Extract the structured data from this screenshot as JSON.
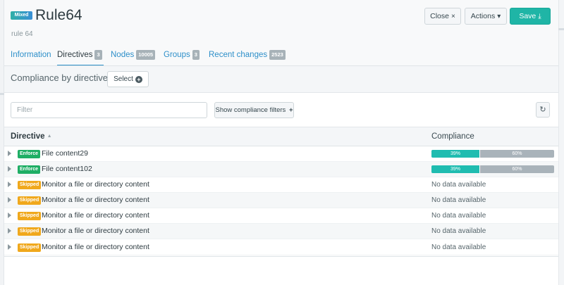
{
  "rule": {
    "mode_badge": "Mixed",
    "title": "Rule64",
    "subtitle": "rule 64"
  },
  "header_buttons": {
    "close_label": "Close",
    "close_icon": "×",
    "actions_label": "Actions",
    "actions_icon": "▾",
    "save_label": "Save",
    "save_icon": "⤓"
  },
  "tabs": [
    {
      "label": "Information",
      "count": ""
    },
    {
      "label": "Directives",
      "count": "3",
      "active": true
    },
    {
      "label": "Nodes",
      "count": "10005"
    },
    {
      "label": "Groups",
      "count": "3"
    },
    {
      "label": "Recent changes",
      "count": "2523"
    }
  ],
  "compliance_section": {
    "title": "Compliance by directives",
    "select_label": "Select",
    "select_icon": "+"
  },
  "filter": {
    "placeholder": "Filter",
    "value": "",
    "show_filters_label": "Show compliance filters",
    "show_filters_icon": "+",
    "refresh_icon": "↻"
  },
  "table": {
    "columns": {
      "directive": "Directive",
      "compliance": "Compliance",
      "sort_icon": "▲"
    },
    "rows": [
      {
        "mode": "Enforce",
        "name": "File content29",
        "compliance": {
          "ok_percent": 39,
          "ok_label": "39%",
          "rest_percent": 60,
          "rest_label": "60%"
        }
      },
      {
        "mode": "Enforce",
        "name": "File content102",
        "compliance": {
          "ok_percent": 39,
          "ok_label": "39%",
          "rest_percent": 60,
          "rest_label": "60%"
        }
      },
      {
        "mode": "Skipped",
        "name": "Monitor a file or directory content",
        "no_data": "No data available"
      },
      {
        "mode": "Skipped",
        "name": "Monitor a file or directory content",
        "no_data": "No data available"
      },
      {
        "mode": "Skipped",
        "name": "Monitor a file or directory content",
        "no_data": "No data available"
      },
      {
        "mode": "Skipped",
        "name": "Monitor a file or directory content",
        "no_data": "No data available"
      },
      {
        "mode": "Skipped",
        "name": "Monitor a file or directory content",
        "no_data": "No data available"
      }
    ]
  },
  "colors": {
    "accent": "#1fb5a6",
    "link": "#2d8fc9",
    "enforce": "#1fae65",
    "skipped": "#f0a81c",
    "compliant": "#1fbcb0",
    "rest": "#a9b3ba"
  }
}
